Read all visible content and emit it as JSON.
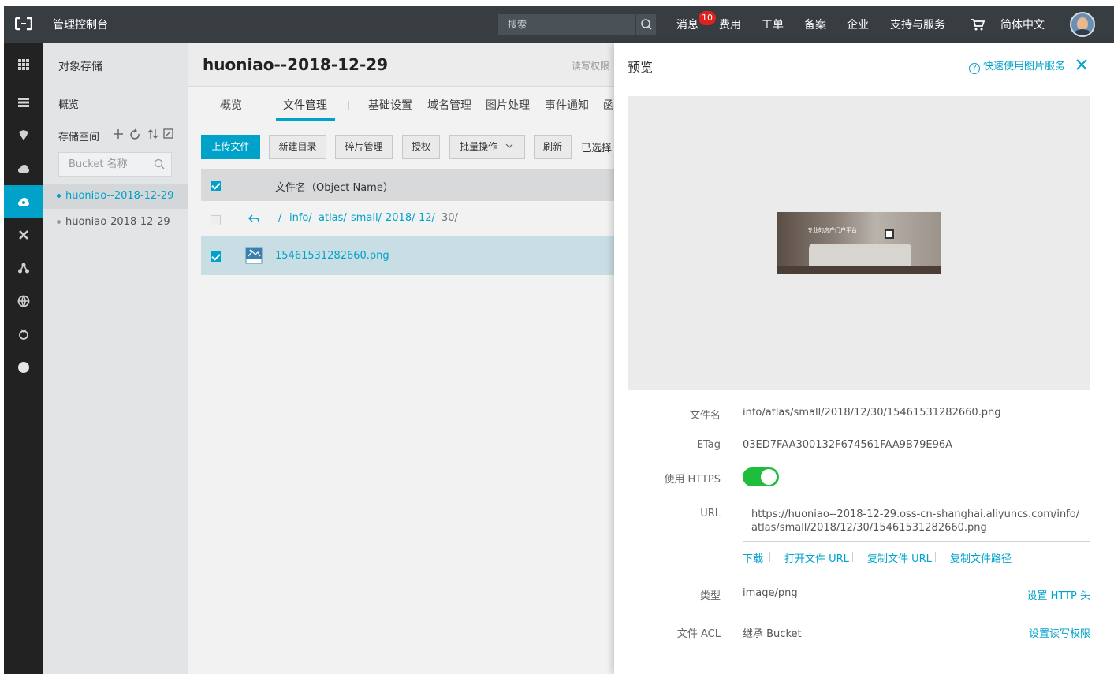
{
  "topbar": {
    "title": "管理控制台",
    "search_placeholder": "搜索",
    "messages_label": "消息",
    "messages_badge": "10",
    "fees": "费用",
    "tickets": "工单",
    "icp": "备案",
    "enterprise": "企业",
    "support": "支持与服务",
    "language": "简体中文"
  },
  "side": {
    "title": "对象存储",
    "overview": "概览",
    "storage_space": "存储空间",
    "search_placeholder": "Bucket 名称",
    "buckets": [
      "huoniao--2018-12-29",
      "huoniao-2018-12-29"
    ]
  },
  "main": {
    "bucket_title": "huoniao--2018-12-29",
    "rw_perm": "读写权限",
    "tabs": [
      "概览",
      "文件管理",
      "基础设置",
      "域名管理",
      "图片处理",
      "事件通知",
      "函"
    ],
    "toolbar": {
      "upload": "上传文件",
      "new_dir": "新建目录",
      "fragments": "碎片管理",
      "authorize": "授权",
      "batch": "批量操作",
      "refresh": "刷新",
      "selected": "已选择"
    },
    "col_name": "文件名（Object Name）",
    "path": [
      "/",
      "info/",
      "atlas/",
      "small/",
      "2018/",
      "12/"
    ],
    "path_tail": "30/",
    "file_name": "15461531282660.png"
  },
  "preview": {
    "title": "预览",
    "help": "快速使用图片服务",
    "image_caption": "专业的房产门户平台",
    "labels": {
      "file_name": "文件名",
      "etag": "ETag",
      "https": "使用 HTTPS",
      "url": "URL",
      "type": "类型",
      "acl": "文件 ACL"
    },
    "file_name": "info/atlas/small/2018/12/30/15461531282660.png",
    "etag": "03ED7FAA300132F674561FAA9B79E96A",
    "https_on": true,
    "url": "https://huoniao--2018-12-29.oss-cn-shanghai.aliyuncs.com/info/atlas/small/2018/12/30/15461531282660.png",
    "actions": [
      "下载",
      "打开文件 URL",
      "复制文件 URL",
      "复制文件路径"
    ],
    "type": "image/png",
    "set_http_header": "设置 HTTP 头",
    "acl": "继承 Bucket",
    "set_acl": "设置读写权限"
  },
  "colors": {
    "accent": "#00a2ca",
    "topbar": "#373d41",
    "rail": "#222222",
    "toggle_on": "#1fbd3c",
    "badge": "#e0221c"
  }
}
